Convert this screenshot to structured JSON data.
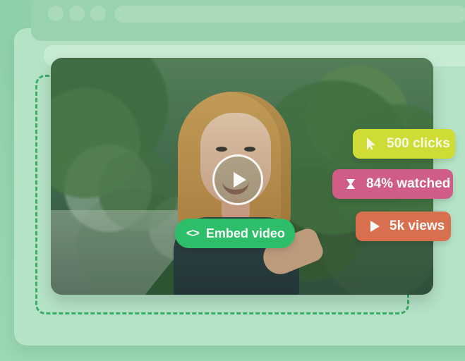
{
  "overlay": {
    "embed_video_label": "Embed video",
    "clicks_label": "500 clicks",
    "watched_label": "84% watched",
    "views_label": "5k views"
  },
  "icons": {
    "embed": "code-icon",
    "clicks": "cursor-icon",
    "watched": "hourglass-icon",
    "views": "play-icon",
    "video_play": "play-icon"
  },
  "colors": {
    "background": "#8fd1a9",
    "dashed_border": "#2ea75f",
    "embed_button": "#2ebd68",
    "clicks_badge": "#cfdc36",
    "watched_badge": "#d05d88",
    "views_badge": "#d8704f"
  }
}
